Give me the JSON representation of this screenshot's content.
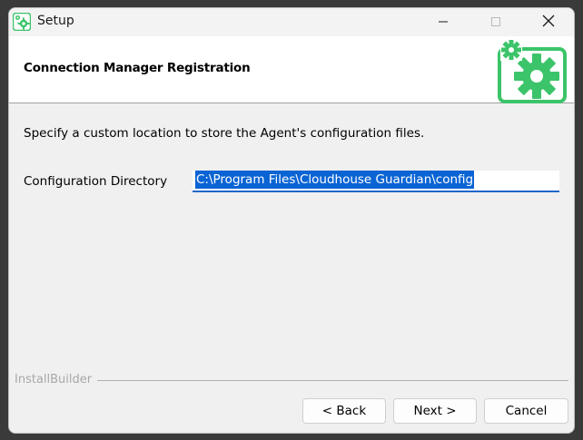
{
  "window": {
    "title": "Setup",
    "app_icon": "gear-icon",
    "controls": {
      "minimize_icon": "minimize-icon",
      "maximize_icon": "maximize-icon",
      "close_icon": "close-icon"
    }
  },
  "header": {
    "title": "Connection Manager Registration",
    "logo_icon": "gears-logo-icon",
    "accent_color": "#3cc46a"
  },
  "body": {
    "instruction": "Specify a custom location to store the Agent's configuration files.",
    "config_dir": {
      "label": "Configuration Directory",
      "value": "C:\\Program Files\\Cloudhouse Guardian\\config"
    }
  },
  "footer": {
    "builder_label": "InstallBuilder",
    "buttons": {
      "back": "< Back",
      "next": "Next >",
      "cancel": "Cancel"
    }
  }
}
